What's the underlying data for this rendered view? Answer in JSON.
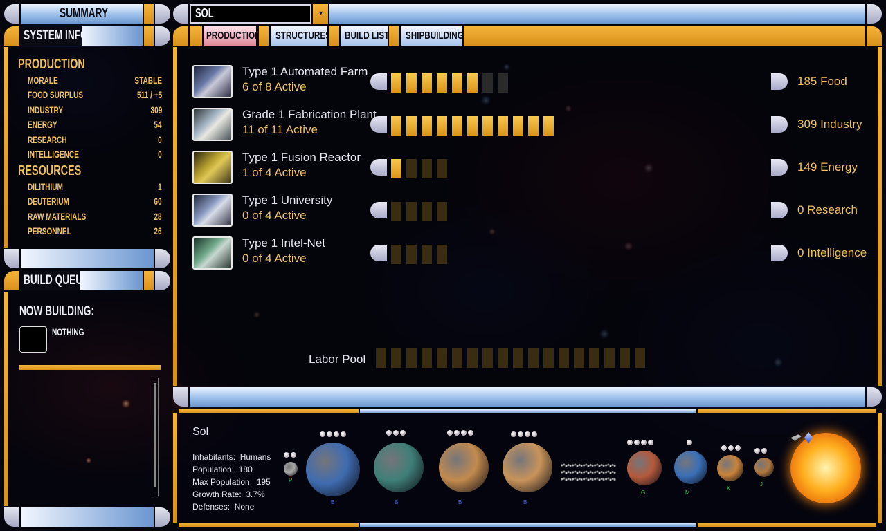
{
  "header": {
    "summary_label": "SUMMARY",
    "system_name": "SOL"
  },
  "sidebar": {
    "system_info_label": "SYSTEM INFO",
    "production_title": "PRODUCTION",
    "production_rows": [
      {
        "label": "MORALE",
        "value": "STABLE"
      },
      {
        "label": "FOOD SURPLUS",
        "value": "511 / +5"
      },
      {
        "label": "INDUSTRY",
        "value": "309"
      },
      {
        "label": "ENERGY",
        "value": "54"
      },
      {
        "label": "RESEARCH",
        "value": "0"
      },
      {
        "label": "INTELLIGENCE",
        "value": "0"
      }
    ],
    "resources_title": "RESOURCES",
    "resource_rows": [
      {
        "label": "DILITHIUM",
        "value": "1"
      },
      {
        "label": "DEUTERIUM",
        "value": "60"
      },
      {
        "label": "RAW MATERIALS",
        "value": "28"
      },
      {
        "label": "PERSONNEL",
        "value": "26"
      }
    ],
    "build_queue_label": "BUILD QUEUE",
    "now_building_label": "NOW BUILDING:",
    "now_building_value": "NOTHING"
  },
  "tabs": [
    {
      "label": "PRODUCTION",
      "active": true
    },
    {
      "label": "STRUCTURES",
      "active": false
    },
    {
      "label": "BUILD LIST",
      "active": false
    },
    {
      "label": "SHIPBUILDING",
      "active": false
    }
  ],
  "production": [
    {
      "name": "Type 1 Automated Farm",
      "status": "6 of 8 Active",
      "active": 6,
      "total": 8,
      "output": "185 Food",
      "icon": "farm-icon"
    },
    {
      "name": "Grade 1 Fabrication Plant",
      "status": "11 of 11 Active",
      "active": 11,
      "total": 11,
      "output": "309 Industry",
      "icon": "fabrication-plant-icon"
    },
    {
      "name": "Type 1 Fusion Reactor",
      "status": "1 of 4 Active",
      "active": 1,
      "total": 4,
      "output": "149 Energy",
      "icon": "fusion-reactor-icon"
    },
    {
      "name": "Type 1 University",
      "status": "0 of 4 Active",
      "active": 0,
      "total": 4,
      "output": "0 Research",
      "icon": "university-icon"
    },
    {
      "name": "Type 1 Intel-Net",
      "status": "0 of 4 Active",
      "active": 0,
      "total": 4,
      "output": "0 Intelligence",
      "icon": "intel-net-icon"
    }
  ],
  "labor_pool": {
    "label": "Labor Pool",
    "slots": 18,
    "filled": 0
  },
  "system": {
    "name": "Sol",
    "inhabitants": {
      "label": "Inhabitants:",
      "value": "Humans"
    },
    "population": {
      "label": "Population:",
      "value": "180"
    },
    "max_population": {
      "label": "Max Population:",
      "value": "195"
    },
    "growth_rate": {
      "label": "Growth Rate:",
      "value": "3.7%"
    },
    "defenses": {
      "label": "Defenses:",
      "value": "None"
    }
  },
  "planets": [
    {
      "name": "pluto",
      "class_label": "P",
      "moons": 2,
      "color": "#a8a8a8"
    },
    {
      "name": "neptune",
      "class_label": "B",
      "moons": 4,
      "color": "#3f6cb0"
    },
    {
      "name": "uranus",
      "class_label": "B",
      "moons": 3,
      "color": "#3f7f78"
    },
    {
      "name": "saturn",
      "class_label": "B",
      "moons": 4,
      "color": "#c28a4e"
    },
    {
      "name": "jupiter",
      "class_label": "B",
      "moons": 4,
      "color": "#c8935a"
    },
    {
      "name": "mars",
      "class_label": "G",
      "moons": 4,
      "color": "#b55a3c"
    },
    {
      "name": "earth",
      "class_label": "M",
      "moons": 1,
      "color": "#3a70b8"
    },
    {
      "name": "venus",
      "class_label": "K",
      "moons": 3,
      "color": "#c8843c"
    },
    {
      "name": "mercury",
      "class_label": "J",
      "moons": 2,
      "color": "#b07840"
    }
  ],
  "colors": {
    "lcars_gold": "#f0b030",
    "lcars_blue": "#a8c8f0",
    "text_gold": "#f0c060",
    "tab_active": "#f2a7b6"
  }
}
